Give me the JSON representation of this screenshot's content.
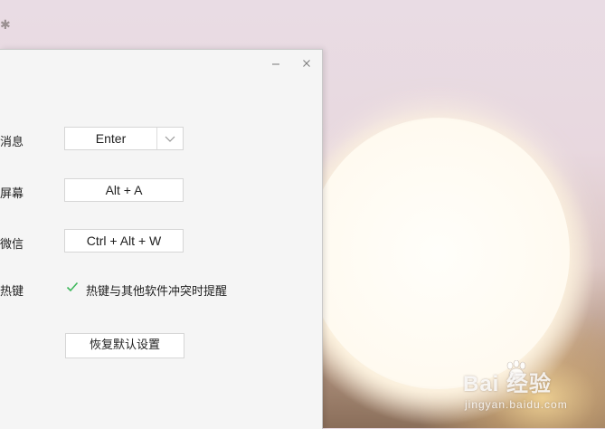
{
  "window": {
    "minimize_icon": "minimize-icon",
    "close_icon": "close-icon"
  },
  "settings": {
    "rows": [
      {
        "label": "消息",
        "value": "Enter",
        "has_dropdown": true
      },
      {
        "label": "屏幕",
        "value": "Alt + A"
      },
      {
        "label": "微信",
        "value": "Ctrl + Alt + W"
      }
    ],
    "hotkey_label": "热键",
    "conflict_checkbox": {
      "checked": true,
      "label": "热键与其他软件冲突时提醒"
    },
    "restore_button": "恢复默认设置"
  },
  "watermark": {
    "brand": "Bai 经验",
    "url": "jingyan.baidu.com"
  },
  "colors": {
    "check": "#3fb85c",
    "panel_bg": "#f5f5f5"
  }
}
